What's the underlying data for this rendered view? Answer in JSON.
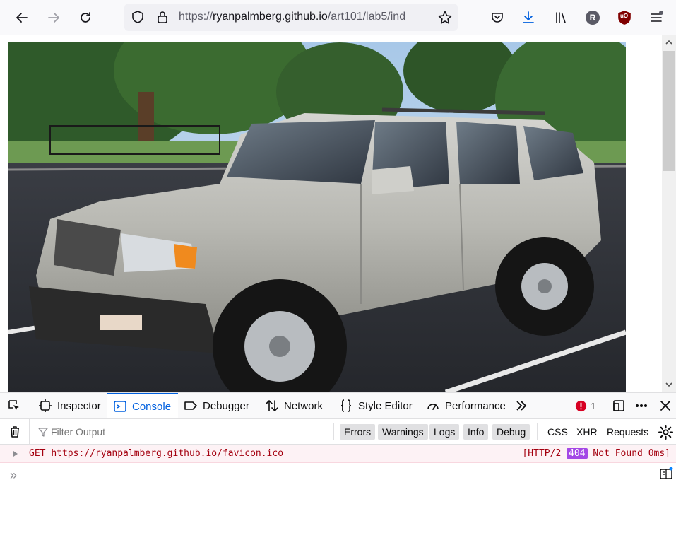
{
  "browser": {
    "url_prefix": "https://",
    "url_host": "ryanpalmberg.github.io",
    "url_path": "/art101/lab5/ind",
    "profile_initial": "R",
    "ublock_label": "uO"
  },
  "page": {
    "image_alt": "Silver Toyota 4Runner SUV parked in a parking lot"
  },
  "devtools": {
    "tabs": [
      {
        "label": "Inspector"
      },
      {
        "label": "Console"
      },
      {
        "label": "Debugger"
      },
      {
        "label": "Network"
      },
      {
        "label": "Style Editor"
      },
      {
        "label": "Performance"
      }
    ],
    "error_count": "1",
    "filter_placeholder": "Filter Output",
    "levels": [
      "Errors",
      "Warnings",
      "Logs",
      "Info",
      "Debug"
    ],
    "types": [
      "CSS",
      "XHR",
      "Requests"
    ],
    "log": {
      "method": "GET",
      "url": "https://ryanpalmberg.github.io/favicon.ico",
      "status_prefix": "[HTTP/2",
      "status_code": "404",
      "status_suffix": "Not Found 0ms]"
    },
    "prompt_symbol": "»"
  },
  "colors": {
    "accent": "#0060df",
    "error_text": "#a4000f",
    "error_bg": "#fdf2f5",
    "badge_404": "#a448e6",
    "download_blue": "#0060df",
    "ublock_red": "#800000"
  }
}
